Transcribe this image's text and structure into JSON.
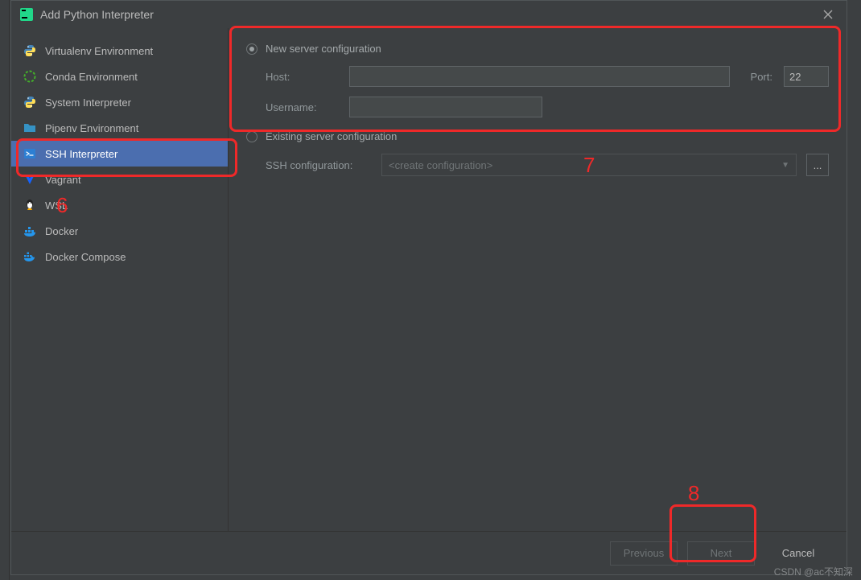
{
  "window": {
    "title": "Add Python Interpreter"
  },
  "sidebar": {
    "items": [
      {
        "label": "Virtualenv Environment",
        "icon": "python-icon"
      },
      {
        "label": "Conda Environment",
        "icon": "conda-icon"
      },
      {
        "label": "System Interpreter",
        "icon": "python-icon"
      },
      {
        "label": "Pipenv Environment",
        "icon": "folder-icon"
      },
      {
        "label": "SSH Interpreter",
        "icon": "ssh-icon",
        "selected": true
      },
      {
        "label": "Vagrant",
        "icon": "vagrant-icon"
      },
      {
        "label": "WSL",
        "icon": "linux-icon"
      },
      {
        "label": "Docker",
        "icon": "docker-icon"
      },
      {
        "label": "Docker Compose",
        "icon": "docker-compose-icon"
      }
    ]
  },
  "form": {
    "new_server_label": "New server configuration",
    "host_label": "Host:",
    "host_value": "",
    "port_label": "Port:",
    "port_value": "22",
    "username_label": "Username:",
    "username_value": "",
    "existing_server_label": "Existing server configuration",
    "ssh_config_label": "SSH configuration:",
    "ssh_config_value": "<create configuration>",
    "ellipsis": "..."
  },
  "buttons": {
    "previous": "Previous",
    "next": "Next",
    "cancel": "Cancel"
  },
  "annotations": {
    "n6": "6",
    "n7": "7",
    "n8": "8"
  },
  "watermark": "CSDN @ac不知深"
}
